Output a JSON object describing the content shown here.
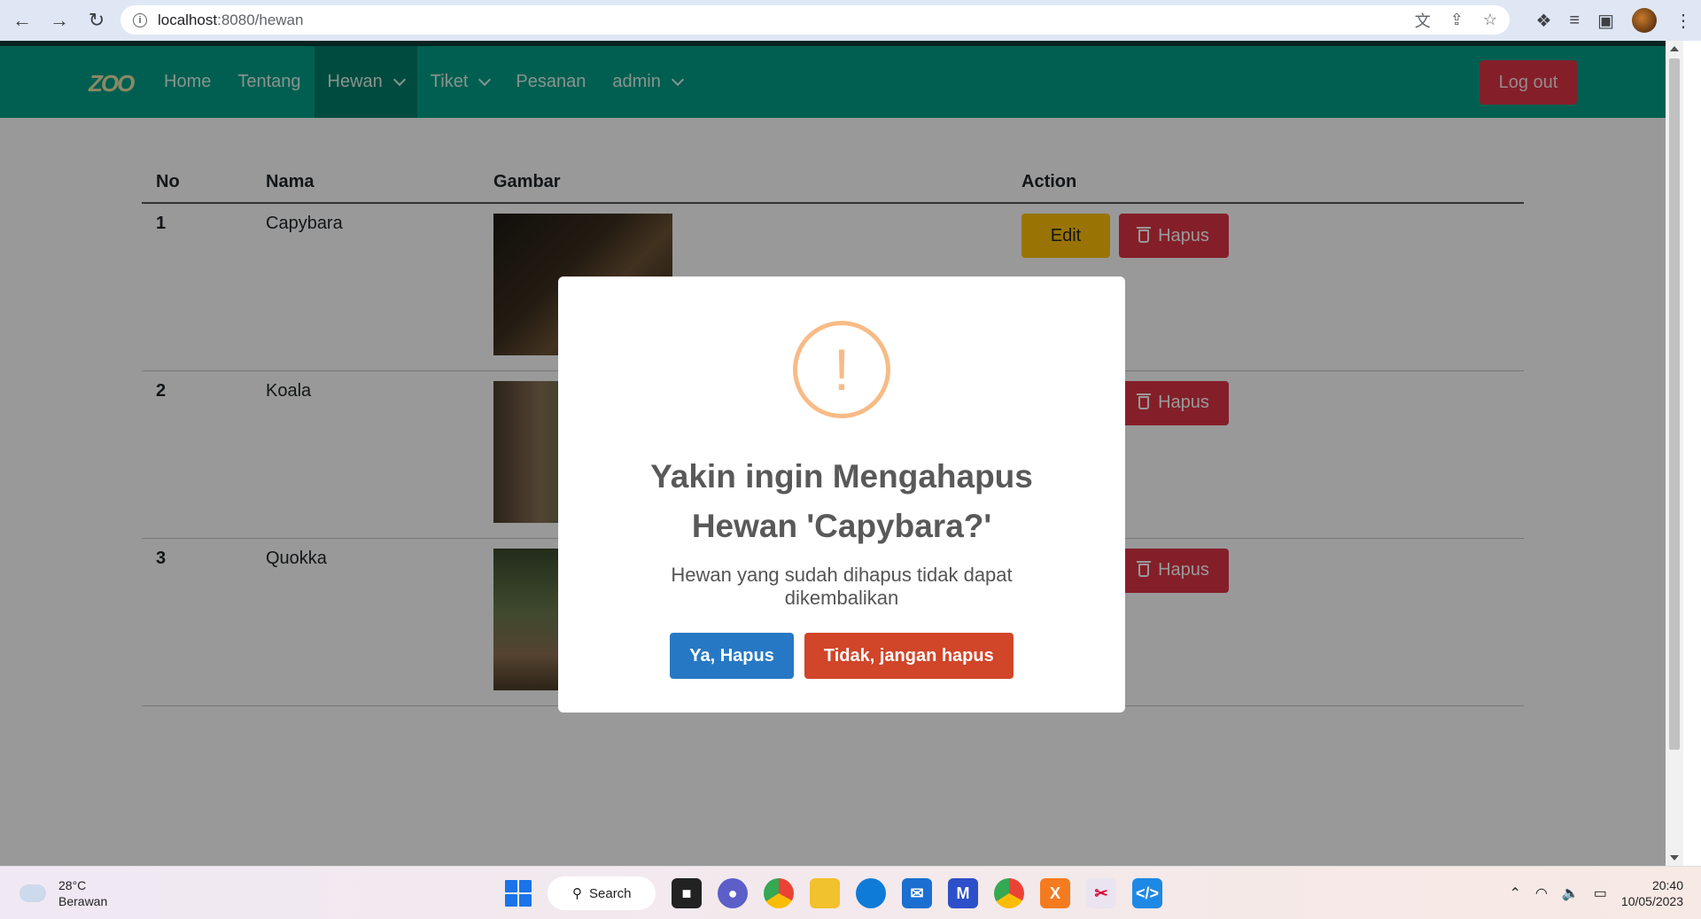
{
  "browser": {
    "url_host": "localhost",
    "url_path": ":8080/hewan",
    "back_icon": "arrow-left",
    "forward_icon": "arrow-right",
    "reload_icon": "reload"
  },
  "navbar": {
    "brand": "ZOO",
    "items": [
      {
        "label": "Home"
      },
      {
        "label": "Tentang"
      },
      {
        "label": "Hewan"
      },
      {
        "label": "Tiket"
      },
      {
        "label": "Pesanan"
      },
      {
        "label": "admin"
      }
    ],
    "logout": "Log out"
  },
  "table": {
    "headers": {
      "no": "No",
      "nama": "Nama",
      "gambar": "Gambar",
      "action": "Action"
    },
    "rows": [
      {
        "no": "1",
        "nama": "Capybara"
      },
      {
        "no": "2",
        "nama": "Koala"
      },
      {
        "no": "3",
        "nama": "Quokka"
      }
    ],
    "edit_label": "Edit",
    "delete_label": "Hapus"
  },
  "modal": {
    "icon": "!",
    "title_line1": "Yakin ingin Mengahapus",
    "title_line2": "Hewan 'Capybara?'",
    "text": "Hewan yang sudah dihapus tidak dapat dikembalikan",
    "confirm": "Ya, Hapus",
    "cancel": "Tidak, jangan hapus"
  },
  "taskbar": {
    "temp": "28°C",
    "weather": "Berawan",
    "search": "Search",
    "time": "20:40",
    "date": "10/05/2023"
  },
  "colors": {
    "navbar": "#009e85",
    "danger": "#dc3545",
    "warning": "#ffc107",
    "confirm": "#2778c4",
    "cancel": "#d14529"
  }
}
